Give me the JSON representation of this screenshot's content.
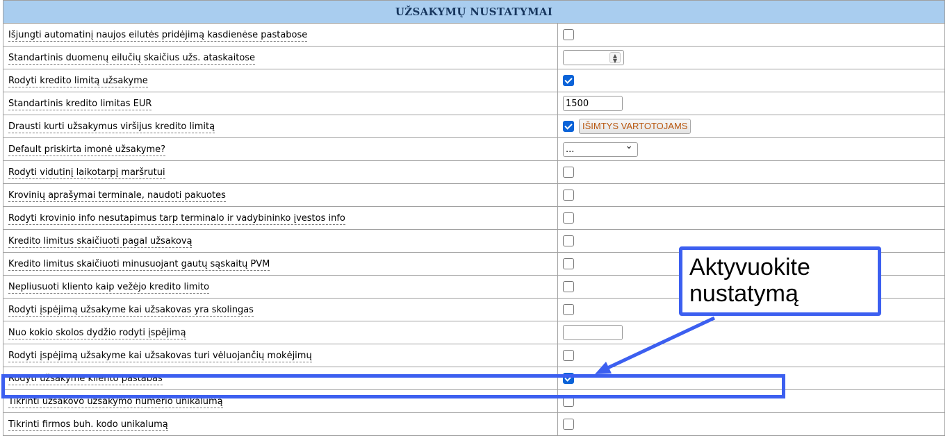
{
  "header": {
    "title": "UŽSAKYMŲ NUSTATYMAI"
  },
  "rows": [
    {
      "label": "Išjungti automatinį naujos eilutės pridėjimą kasdienėse pastabose",
      "control": "checkbox",
      "checked": false
    },
    {
      "label": "Standartinis duomenų eilučių skaičius užs. ataskaitose",
      "control": "number",
      "value": ""
    },
    {
      "label": "Rodyti kredito limitą užsakyme",
      "control": "checkbox",
      "checked": true
    },
    {
      "label": "Standartinis kredito limitas EUR",
      "control": "text",
      "value": "1500"
    },
    {
      "label": "Drausti kurti užsakymus viršijus kredito limitą",
      "control": "checkbox",
      "checked": true
    },
    {
      "label": "Default priskirta imonė užsakyme?",
      "control": "select",
      "value": "..."
    },
    {
      "label": "Rodyti vidutinį laikotarpį maršrutui",
      "control": "checkbox",
      "checked": false
    },
    {
      "label": "Krovinių aprašymai terminale, naudoti pakuotes",
      "control": "checkbox",
      "checked": false
    },
    {
      "label": "Rodyti krovinio info nesutapimus tarp terminalo ir vadybininko įvestos info",
      "control": "checkbox",
      "checked": false
    },
    {
      "label": "Kredito limitus skaičiuoti pagal užsakovą",
      "control": "checkbox",
      "checked": false
    },
    {
      "label": "Kredito limitus skaičiuoti minusuojant gautų sąskaitų PVM",
      "control": "checkbox",
      "checked": false
    },
    {
      "label": "Nepliusuoti kliento kaip vežėjo kredito limito",
      "control": "checkbox",
      "checked": false
    },
    {
      "label": "Rodyti įspėjimą užsakyme kai užsakovas yra skolingas",
      "control": "checkbox",
      "checked": false
    },
    {
      "label": "Nuo kokio skolos dydžio rodyti įspėjimą",
      "control": "text",
      "value": ""
    },
    {
      "label": "Rodyti įspėjimą užsakyme kai užsakovas turi vėluojančių mokėjimų",
      "control": "checkbox",
      "checked": false
    },
    {
      "label": "Rodyti užsakyme kliento pastabas",
      "control": "checkbox",
      "checked": true
    },
    {
      "label": "Tikrinti užsakovo užsakymo numerio unikalumą",
      "control": "checkbox",
      "checked": false
    },
    {
      "label": "Tikrinti firmos buh. kodo unikalumą",
      "control": "checkbox",
      "checked": false
    }
  ],
  "exceptions_button": {
    "label": "IŠIMTYS VARTOTOJAMS"
  },
  "callout": {
    "text": "Aktyvuokite\nnustatymą"
  },
  "colors": {
    "header_bg": "#a9cdef",
    "accent": "#3c5ff0",
    "checkbox": "#0b63d8",
    "button_text": "#b8570f"
  }
}
